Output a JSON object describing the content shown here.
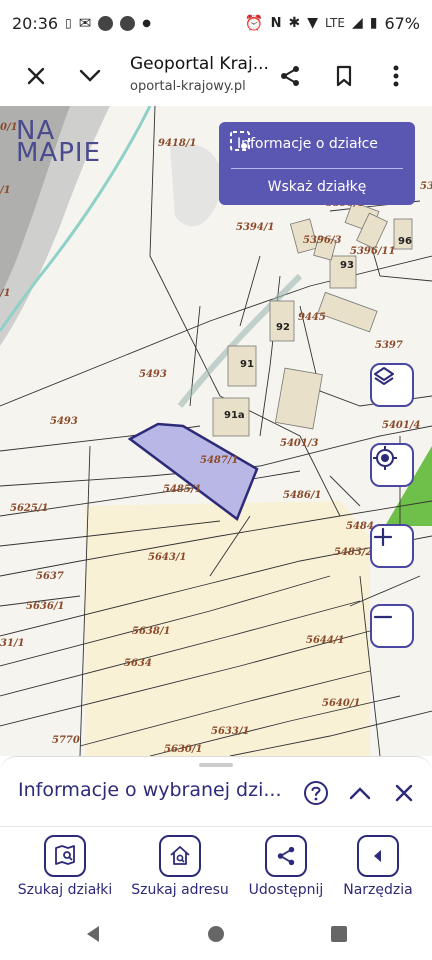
{
  "status_bar": {
    "time": "20:36",
    "battery": "67%",
    "lte": "LTE"
  },
  "browser": {
    "title": "Geoportal Kraj...",
    "url": "oportal-krajowy.pl"
  },
  "map": {
    "logo_line1": "NA",
    "logo_line2": "MAPIE",
    "info_panel": {
      "title": "Informacje o działce",
      "action": "Wskaż działkę"
    },
    "parcel_labels": [
      "9418/1",
      "5394/1",
      "5396/1",
      "5396/3",
      "5396/11",
      "93",
      "96",
      "53",
      "92",
      "9445",
      "5397",
      "91",
      "91a",
      "5493",
      "5493",
      "5401/3",
      "5401/4",
      "5487/1",
      "5485/1",
      "5486/1",
      "5484",
      "5483/2",
      "5625/1",
      "5643/1",
      "5637",
      "5636/1",
      "5638/1",
      "5644/1",
      "5634",
      "31/1",
      "5640/1",
      "5633/1",
      "5630/1",
      "5770",
      "0/1",
      "/1",
      "/1"
    ]
  },
  "sheet": {
    "title": "Informacje o wybranej dzi..."
  },
  "bottom_nav": {
    "items": [
      {
        "label": "Szukaj działki"
      },
      {
        "label": "Szukaj adresu"
      },
      {
        "label": "Udostępnij"
      },
      {
        "label": "Narzędzia"
      }
    ]
  },
  "colors": {
    "accent": "#2d2a78",
    "panel": "#5a57b3",
    "parcel_fill": "#b9b7e6",
    "zone_fill": "#f8f1d6",
    "green": "#6fbf4b"
  }
}
